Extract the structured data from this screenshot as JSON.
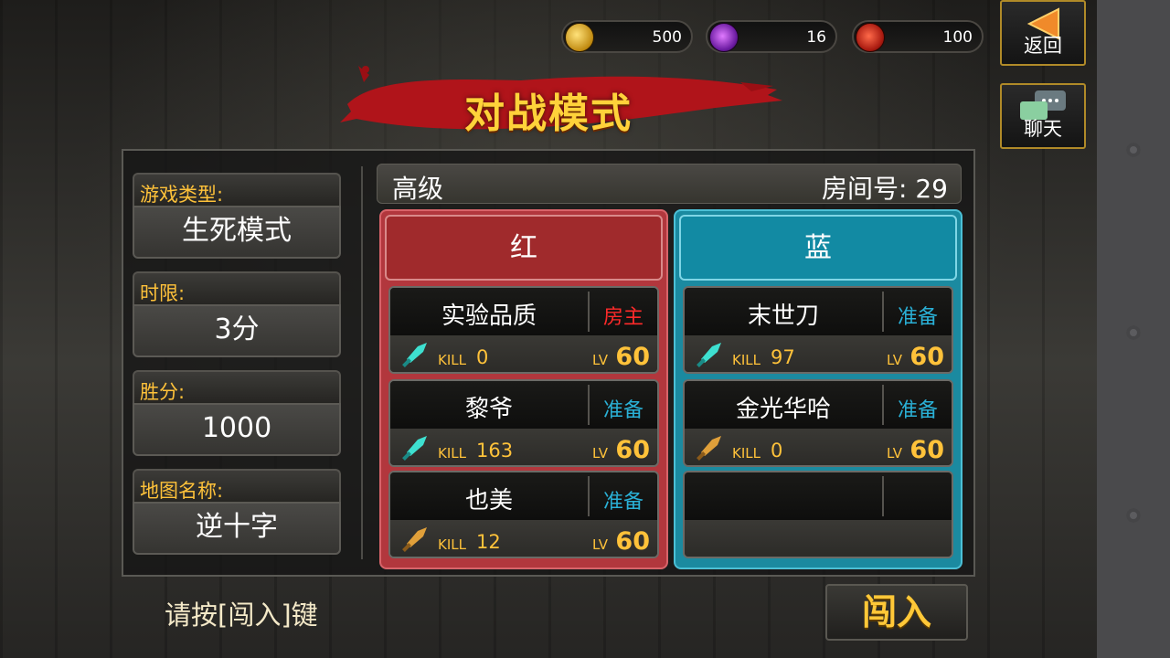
{
  "currencies": [
    {
      "icon": "gold-coin-icon",
      "value": "500"
    },
    {
      "icon": "purple-gem-icon",
      "value": "16"
    },
    {
      "icon": "red-ticket-icon",
      "value": "100"
    }
  ],
  "side_buttons": {
    "back_label": "返回",
    "chat_label": "聊天"
  },
  "title": "对战模式",
  "game_info": {
    "type_label": "游戏类型:",
    "type_value": "生死模式",
    "time_label": "时限:",
    "time_value": "3分",
    "score_label": "胜分:",
    "score_value": "1000",
    "map_label": "地图名称:",
    "map_value": "逆十字"
  },
  "room": {
    "level": "高级",
    "number_text": "房间号: 29"
  },
  "teams": {
    "red": {
      "label": "红",
      "players": [
        {
          "name": "实验品质",
          "status": "房主",
          "weapon": "cyan-dagger-icon",
          "kill_label": "KILL",
          "kills": "0",
          "lv_label": "LV",
          "level": "60"
        },
        {
          "name": "黎爷",
          "status": "准备",
          "weapon": "cyan-dagger-icon",
          "kill_label": "KILL",
          "kills": "163",
          "lv_label": "LV",
          "level": "60"
        },
        {
          "name": "也美",
          "status": "准备",
          "weapon": "gold-dagger-icon",
          "kill_label": "KILL",
          "kills": "12",
          "lv_label": "LV",
          "level": "60"
        }
      ]
    },
    "blue": {
      "label": "蓝",
      "players": [
        {
          "name": "末世刀",
          "status": "准备",
          "weapon": "cyan-dagger-icon",
          "kill_label": "KILL",
          "kills": "97",
          "lv_label": "LV",
          "level": "60"
        },
        {
          "name": "金光华哈",
          "status": "准备",
          "weapon": "gold-dagger-icon",
          "kill_label": "KILL",
          "kills": "0",
          "lv_label": "LV",
          "level": "60"
        }
      ]
    }
  },
  "hint": "请按[闯入]键",
  "enter_label": "闯入",
  "colors": {
    "accent_gold": "#ffc23a",
    "team_red": "#b2373d",
    "team_blue": "#1b8aa0",
    "host_red": "#ff2a2a",
    "ready_cyan": "#2ab0d6"
  }
}
